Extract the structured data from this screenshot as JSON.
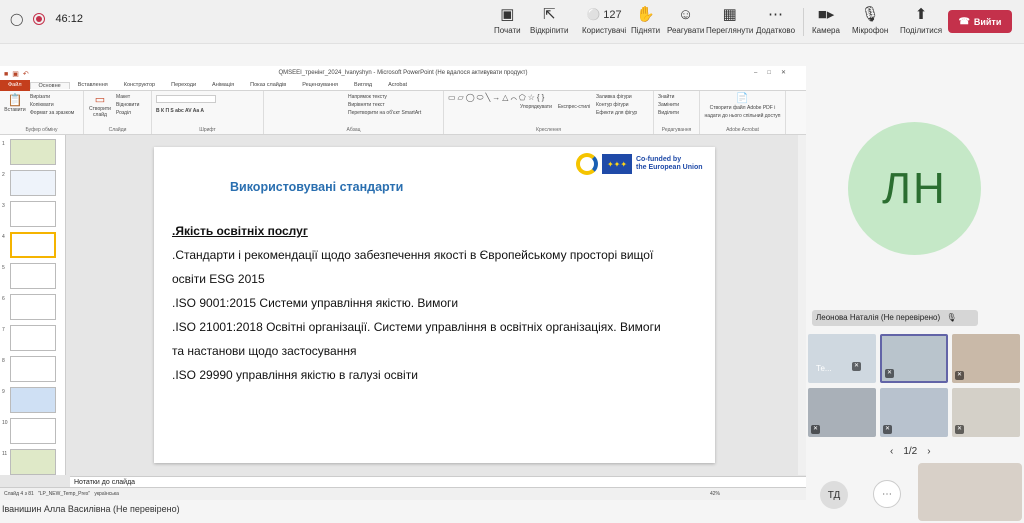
{
  "meeting": {
    "timer": "46:12",
    "participants_count": "127",
    "toolbar": [
      {
        "label": "Почати",
        "icon": "chat-icon"
      },
      {
        "label": "Відкріпити",
        "icon": "unpin-icon"
      },
      {
        "label": "Користувачі",
        "icon": "people-icon"
      },
      {
        "label": "Підняти",
        "icon": "raise-hand-icon"
      },
      {
        "label": "Реагувати",
        "icon": "react-icon"
      },
      {
        "label": "Переглянути",
        "icon": "view-icon"
      },
      {
        "label": "Додатково",
        "icon": "more-icon"
      },
      {
        "label": "Камера",
        "icon": "camera-icon"
      },
      {
        "label": "Мікрофон",
        "icon": "mic-off-icon"
      },
      {
        "label": "Поділитися",
        "icon": "share-icon"
      }
    ],
    "leave_label": "Вийти",
    "leave_color": "#c4314b"
  },
  "powerpoint": {
    "window_title": "QMSEEI_тренінг_2024_Ivanyshyn  -  Microsoft PowerPoint (Не вдалося активувати продукт)",
    "tabs": [
      "Файл",
      "Основне",
      "Вставлення",
      "Конструктор",
      "Переходи",
      "Анімація",
      "Показ слайдів",
      "Рецензування",
      "Вигляд",
      "Acrobat"
    ],
    "ribbon_groups": [
      {
        "name": "Буфер обміну",
        "lines": [
          "Вирізати",
          "Копіювати",
          "Формат за зразком"
        ],
        "big": "Вставити"
      },
      {
        "name": "Слайди",
        "lines": [
          "Макет",
          "Відновити",
          "Розділ"
        ],
        "big": "Створити слайд"
      },
      {
        "name": "Шрифт",
        "lines": [
          "В  К  П  S  abc  AV  Aa  A"
        ]
      },
      {
        "name": "Абзац",
        "lines": [
          "Напрямок тексту",
          "Вирівняти текст",
          "Перетворити на об'єкт SmartArt"
        ]
      },
      {
        "name": "Креслення",
        "lines": [
          "Упорядкувати",
          "Експрес-стилі",
          "Заливка фігури",
          "Контур фігури",
          "Ефекти для фігур"
        ]
      },
      {
        "name": "Редагування",
        "lines": [
          "Знайти",
          "Замінити",
          "Виділити"
        ]
      },
      {
        "name": "Adobe Acrobat",
        "lines": [
          "Створити файл Adobe PDF і",
          "надати до нього спільний доступ"
        ]
      }
    ],
    "slide_numbers": [
      "1",
      "2",
      "3",
      "4",
      "5",
      "6",
      "7",
      "8",
      "9",
      "10",
      "11"
    ],
    "selected_slide": "4",
    "slide": {
      "title": "Використовувані стандарти",
      "eu_text_1": "Co-funded by",
      "eu_text_2": "the European Union",
      "bullets": [
        ".Якість освітніх послуг",
        ".Стандарти і рекомендації щодо забезпечення якості в Європейському просторі вищої",
        "освіти ESG 2015",
        ".ISO 9001:2015 Системи управління якістю. Вимоги",
        ".ISO 21001:2018 Освітні організації. Системи управління в освітніх організаціях. Вимоги",
        "та настанови щодо застосування",
        ".ISO 29990 управління якістю в галузі освіти"
      ]
    },
    "notes_placeholder": "Нотатки до слайда",
    "status": {
      "slide": "Слайд 4 з 81",
      "theme": "\"LP_NEW_Temp_Pres\"",
      "lang": "українська",
      "zoom": "42%"
    }
  },
  "presenter_name": "Іванишин Алла Василівна (Не перевірено)",
  "right_panel": {
    "big_avatar_initials": "ЛН",
    "big_avatar_name": "Леонова Наталія (Не перевірено)",
    "tile_first_label": "Те...",
    "pager": "1/2",
    "td_initials": "ТД"
  }
}
